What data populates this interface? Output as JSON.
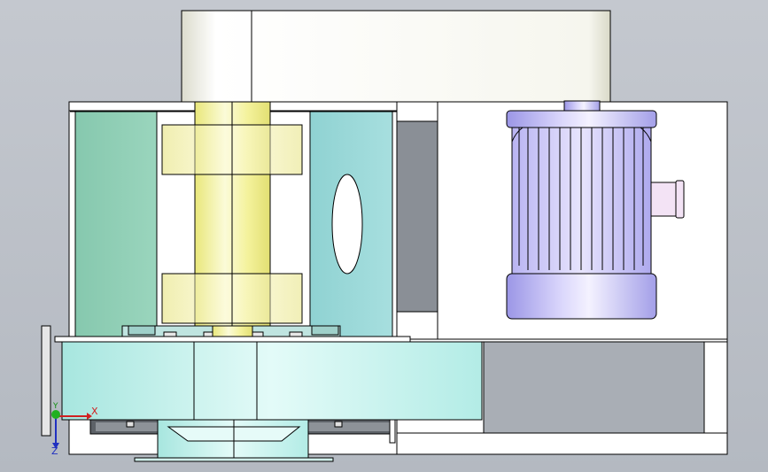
{
  "viewport": {
    "background_top": "#c4c8cf",
    "background_bottom": "#b4b9c1"
  },
  "colors": {
    "outline": "#000000",
    "frame_fill": "#ffffff",
    "panel_green": "#8fcfb6",
    "panel_cyan": "#9ad8d8",
    "hood_fill": "#f3f3ea",
    "shaft_yellow": "#f4f29c",
    "pulley_yellow": "#f7f5c0",
    "motor_purple": "#b3aef0",
    "fan_housing": "#bcefe9",
    "motor_terminal": "#f3e3f5"
  },
  "triad": {
    "x_label": "X",
    "y_label": "Y",
    "z_label": "Z",
    "x_color": "#d02020",
    "y_color": "#109010",
    "z_color": "#2030c0"
  }
}
